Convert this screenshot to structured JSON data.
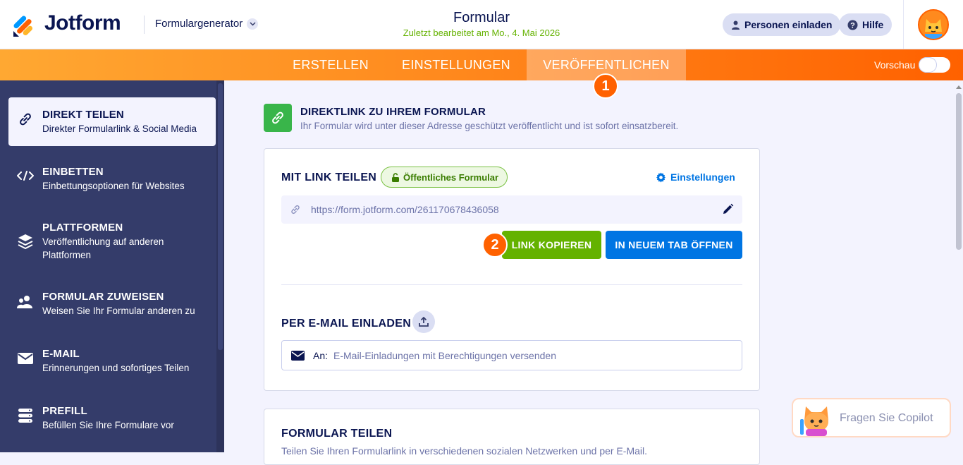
{
  "header": {
    "logo_text": "Jotform",
    "builder_name": "Formulargenerator",
    "form_title": "Formular",
    "last_edited": "Zuletzt bearbeitet am Mo., 4. Mai 2026",
    "invite_label": "Personen einladen",
    "help_label": "Hilfe"
  },
  "nav": {
    "tabs": [
      {
        "label": "ERSTELLEN"
      },
      {
        "label": "EINSTELLUNGEN"
      },
      {
        "label": "VERÖFFENTLICHEN"
      }
    ],
    "active_tab": "VERÖFFENTLICHEN",
    "preview_label": "Vorschau",
    "preview_on": false
  },
  "badges": [
    "1",
    "2"
  ],
  "sidebar": {
    "items": [
      {
        "title": "DIREKT TEILEN",
        "desc": "Direkter Formularlink & Social Media",
        "icon": "link-icon",
        "active": true
      },
      {
        "title": "EINBETTEN",
        "desc": "Einbettungsoptionen für Websites",
        "icon": "code-icon"
      },
      {
        "title": "PLATTFORMEN",
        "desc": "Veröffentlichung auf anderen Plattformen",
        "icon": "layers-icon"
      },
      {
        "title": "FORMULAR ZUWEISEN",
        "desc": "Weisen Sie Ihr Formular anderen zu",
        "icon": "users-icon"
      },
      {
        "title": "E-MAIL",
        "desc": "Erinnerungen und sofortiges Teilen",
        "icon": "envelope-icon"
      },
      {
        "title": "PREFILL",
        "desc": "Befüllen Sie Ihre Formulare vor",
        "icon": "database-icon"
      }
    ]
  },
  "main": {
    "header_title": "DIREKTLINK ZU IHREM FORMULAR",
    "header_desc": "Ihr Formular wird unter dieser Adresse geschützt veröffentlicht und ist sofort einsatzbereit.",
    "share_link_title": "MIT LINK TEILEN",
    "public_badge": "Öffentliches Formular",
    "settings_link": "Einstellungen",
    "form_url": "https://form.jotform.com/261170678436058",
    "copy_button": "LINK KOPIEREN",
    "open_tab_button": "IN NEUEM TAB ÖFFNEN",
    "email_title": "PER E-MAIL EINLADEN",
    "email_label": "An:",
    "email_placeholder": "E-Mail-Einladungen mit Berechtigungen versenden",
    "share_form_title": "FORMULAR TEILEN",
    "share_form_desc": "Teilen Sie Ihren Formularlink in verschiedenen sozialen Netzwerken und per E-Mail."
  },
  "copilot": {
    "label": "Fragen Sie Copilot"
  },
  "colors": {
    "brand_orange": "#ff6100",
    "sidebar_bg": "#343c6a",
    "green_button": "#64b200",
    "blue_button": "#0075e3",
    "link_icon_bg": "#39b54a"
  }
}
